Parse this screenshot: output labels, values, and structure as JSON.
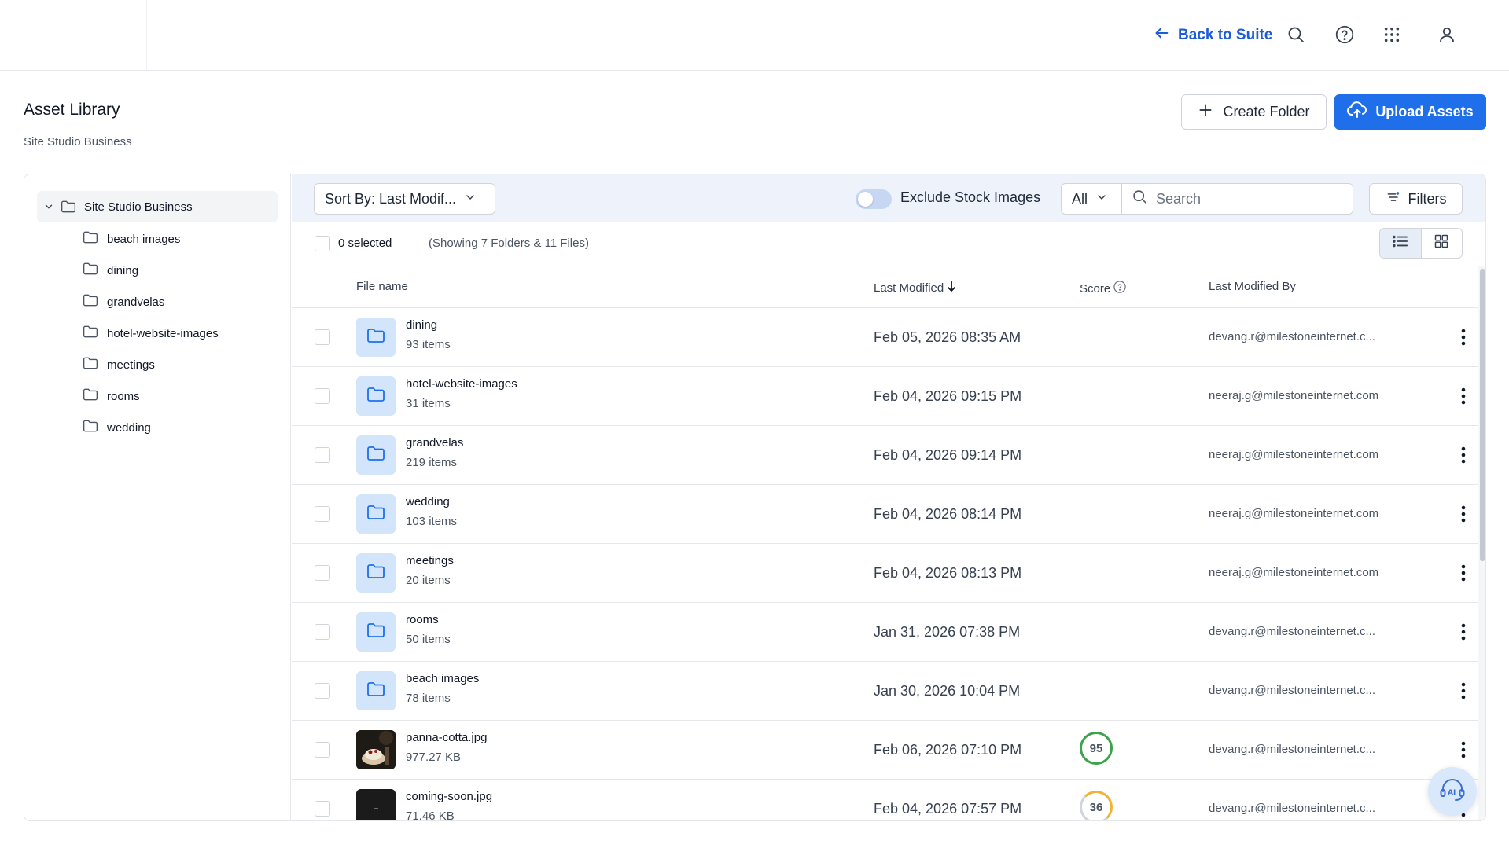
{
  "header": {
    "back_label": "Back to Suite",
    "icons": [
      "search-icon",
      "help-icon",
      "apps-grid-icon",
      "user-icon"
    ]
  },
  "page": {
    "title": "Asset Library",
    "subtitle": "Site Studio Business",
    "create_folder_label": "Create Folder",
    "upload_label": "Upload Assets"
  },
  "sidebar": {
    "root": "Site Studio Business",
    "items": [
      {
        "label": "beach images"
      },
      {
        "label": "dining"
      },
      {
        "label": "grandvelas"
      },
      {
        "label": "hotel-website-images"
      },
      {
        "label": "meetings"
      },
      {
        "label": "rooms"
      },
      {
        "label": "wedding"
      }
    ]
  },
  "toolbar": {
    "sort_label": "Sort By: Last Modif...",
    "exclude_label": "Exclude Stock Images",
    "exclude_on": false,
    "type_filter": "All",
    "search_placeholder": "Search",
    "filters_label": "Filters"
  },
  "selection": {
    "count_label": "0 selected",
    "showing_label": "(Showing 7 Folders & 11 Files)"
  },
  "table": {
    "columns": {
      "name": "File name",
      "modified": "Last Modified",
      "score": "Score",
      "modified_by": "Last Modified By"
    },
    "rows": [
      {
        "name": "dining",
        "sub": "93 items",
        "date": "Feb 05, 2026 08:35 AM",
        "by": "devang.r@milestoneinternet.c...",
        "type": "folder",
        "score": null
      },
      {
        "name": "hotel-website-images",
        "sub": "31 items",
        "date": "Feb 04, 2026 09:15 PM",
        "by": "neeraj.g@milestoneinternet.com",
        "type": "folder",
        "score": null
      },
      {
        "name": "grandvelas",
        "sub": "219 items",
        "date": "Feb 04, 2026 09:14 PM",
        "by": "neeraj.g@milestoneinternet.com",
        "type": "folder",
        "score": null
      },
      {
        "name": "wedding",
        "sub": "103 items",
        "date": "Feb 04, 2026 08:14 PM",
        "by": "neeraj.g@milestoneinternet.com",
        "type": "folder",
        "score": null
      },
      {
        "name": "meetings",
        "sub": "20 items",
        "date": "Feb 04, 2026 08:13 PM",
        "by": "neeraj.g@milestoneinternet.com",
        "type": "folder",
        "score": null
      },
      {
        "name": "rooms",
        "sub": "50 items",
        "date": "Jan 31, 2026 07:38 PM",
        "by": "devang.r@milestoneinternet.c...",
        "type": "folder",
        "score": null
      },
      {
        "name": "beach images",
        "sub": "78 items",
        "date": "Jan 30, 2026 10:04 PM",
        "by": "devang.r@milestoneinternet.c...",
        "type": "folder",
        "score": null
      },
      {
        "name": "panna-cotta.jpg",
        "sub": "977.27 KB",
        "date": "Feb 06, 2026 07:10 PM",
        "by": "devang.r@milestoneinternet.c...",
        "type": "image",
        "score": "95",
        "score_color": "#3fa34d"
      },
      {
        "name": "coming-soon.jpg",
        "sub": "71.46 KB",
        "date": "Feb 04, 2026 07:57 PM",
        "by": "devang.r@milestoneinternet.c...",
        "type": "image-dark",
        "score": "36",
        "score_color": "#f2b233"
      }
    ]
  },
  "colors": {
    "accent": "#1f6feb",
    "link": "#1d5bd8",
    "toolbar_bg": "#edf2fb",
    "folder_bg": "#d3e5fb"
  }
}
